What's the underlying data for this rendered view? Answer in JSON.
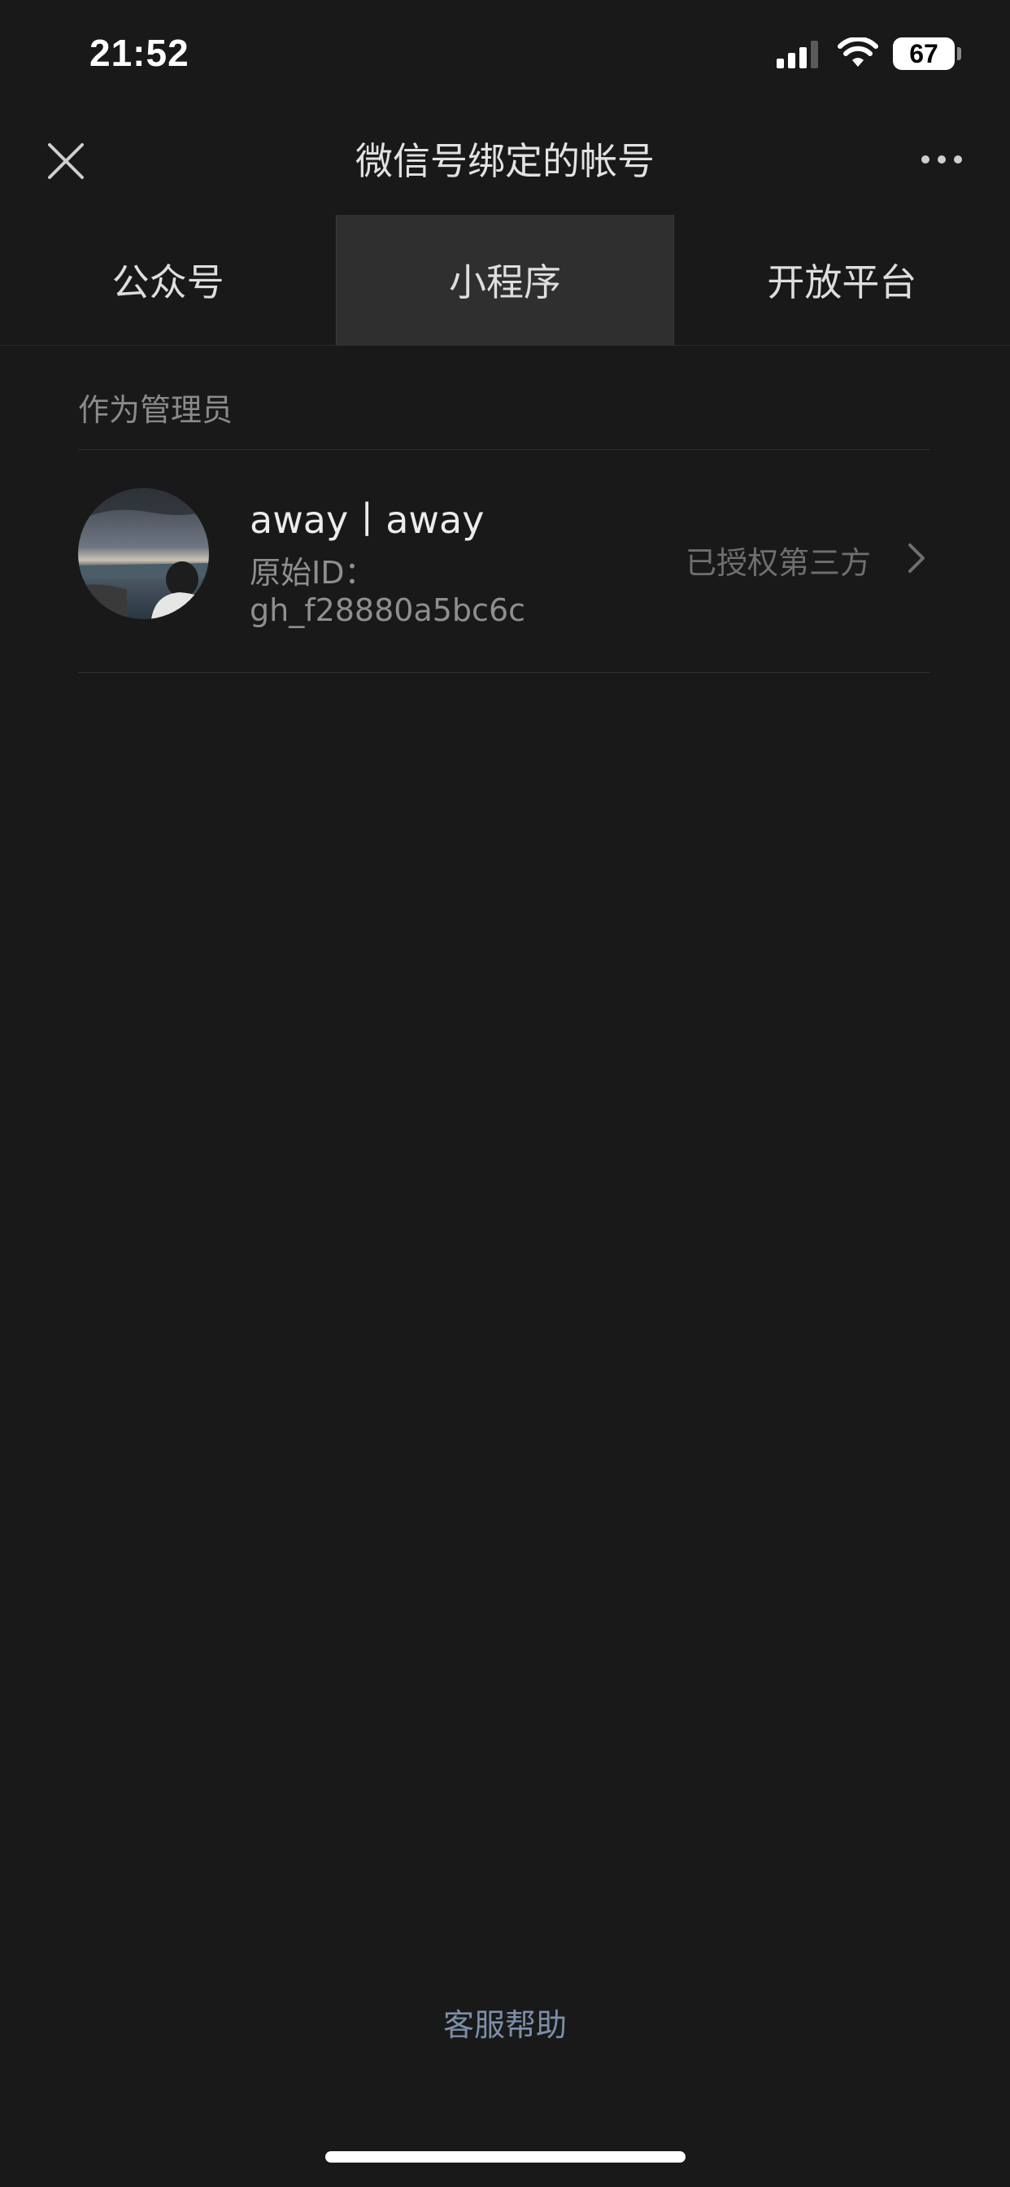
{
  "status_bar": {
    "time": "21:52",
    "battery": "67"
  },
  "nav": {
    "title": "微信号绑定的帐号",
    "close_icon": "close-icon",
    "more_icon": "more-icon"
  },
  "tabs": [
    {
      "label": "公众号",
      "active": false
    },
    {
      "label": "小程序",
      "active": true
    },
    {
      "label": "开放平台",
      "active": false
    }
  ],
  "section": {
    "label": "作为管理员"
  },
  "items": [
    {
      "name": "away丨away",
      "id_label": "原始ID：",
      "id_value": "gh_f28880a5bc6c",
      "status": "已授权第三方"
    }
  ],
  "footer": {
    "help": "客服帮助"
  },
  "colors": {
    "background": "#191919",
    "active_tab": "#2f2f2f",
    "link": "#7c8fa8"
  }
}
